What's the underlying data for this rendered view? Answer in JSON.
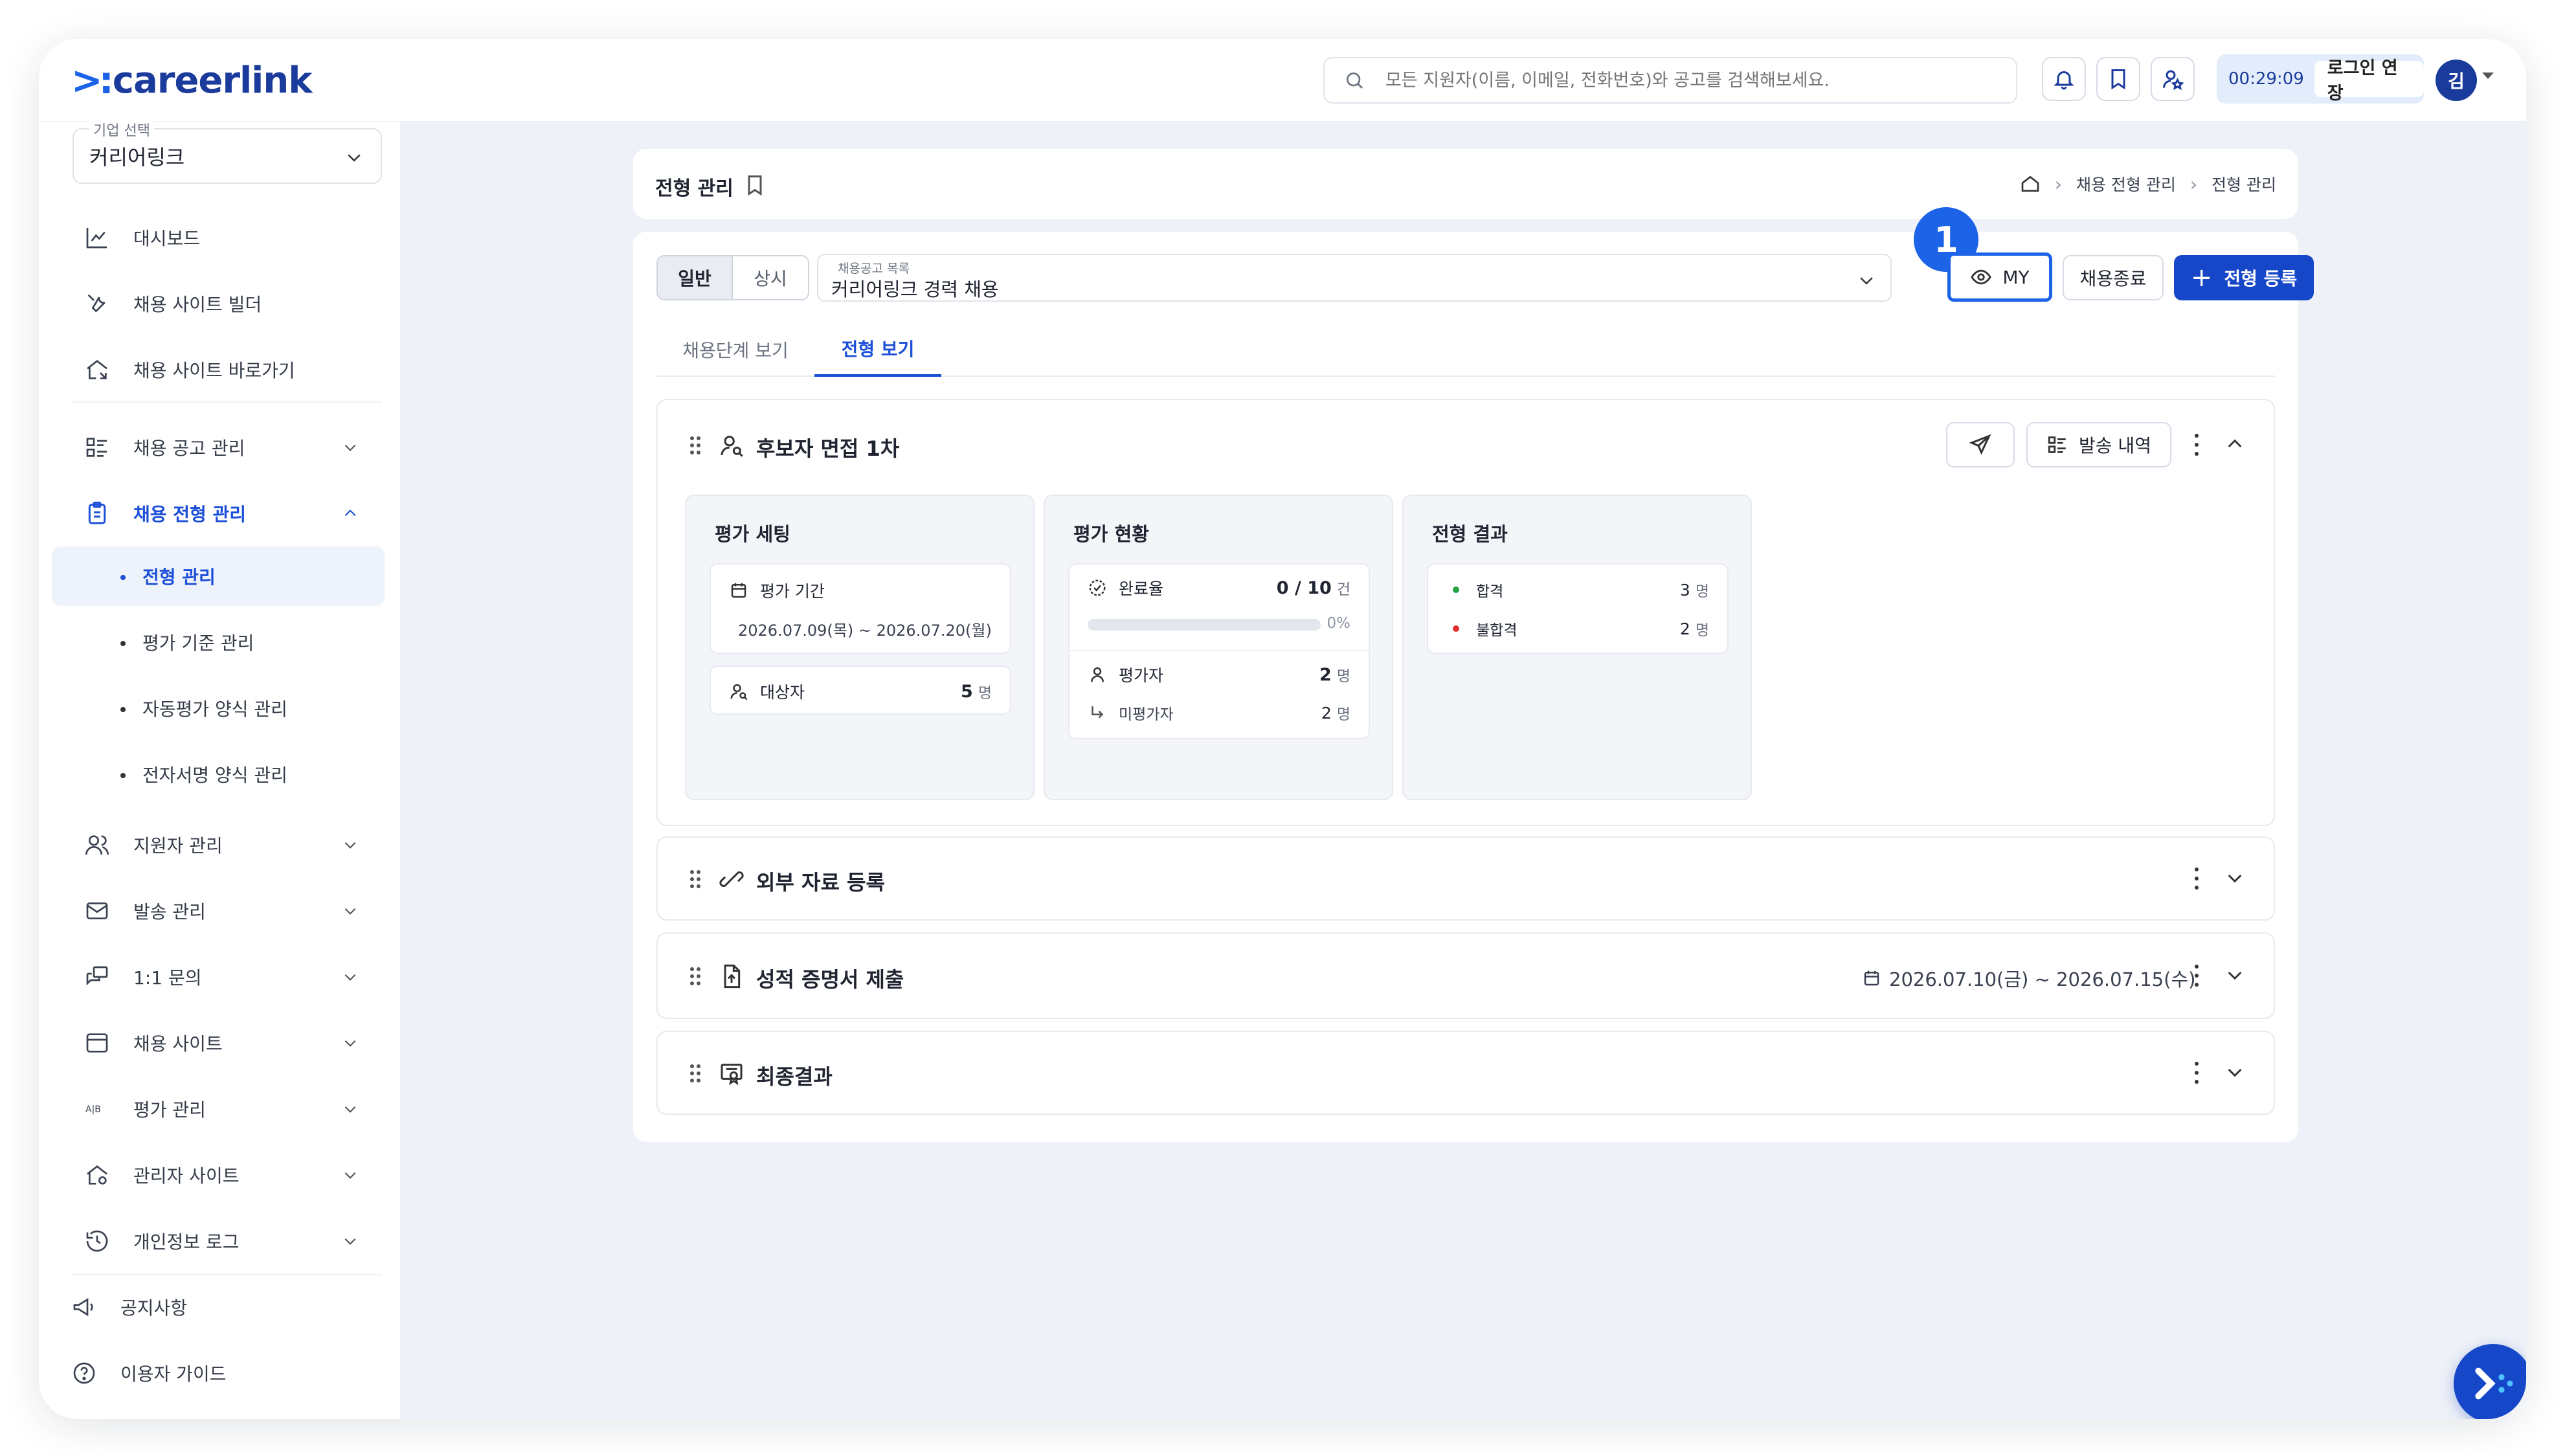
{
  "header": {
    "logo_mark": ">:",
    "logo_text": "careerlink",
    "search_placeholder": "모든 지원자(이름, 이메일, 전화번호)와 공고를 검색해보세요.",
    "timer": "00:29:09",
    "extend_label": "로그인 연장",
    "avatar_initial": "김"
  },
  "sidebar": {
    "company_label": "기업 선택",
    "company_value": "커리어링크",
    "items": [
      {
        "label": "대시보드",
        "icon": "chart-icon"
      },
      {
        "label": "채용 사이트 빌더",
        "icon": "tools-icon"
      },
      {
        "label": "채용 사이트 바로가기",
        "icon": "home-link-icon"
      },
      {
        "label": "채용 공고 관리",
        "icon": "list-icon"
      },
      {
        "label": "채용 전형 관리",
        "icon": "clipboard-icon"
      },
      {
        "label": "지원자 관리",
        "icon": "users-icon"
      },
      {
        "label": "발송 관리",
        "icon": "mail-icon"
      },
      {
        "label": "1:1 문의",
        "icon": "chat-icon"
      },
      {
        "label": "채용 사이트",
        "icon": "browser-icon"
      },
      {
        "label": "평가 관리",
        "icon": "ab-icon"
      },
      {
        "label": "관리자 사이트",
        "icon": "admin-home-icon"
      },
      {
        "label": "개인정보 로그",
        "icon": "history-icon"
      },
      {
        "label": "공지사항",
        "icon": "megaphone-icon"
      },
      {
        "label": "이용자 가이드",
        "icon": "help-icon"
      }
    ],
    "sub_items": [
      "전형 관리",
      "평가 기준 관리",
      "자동평가 양식 관리",
      "전자서명 양식 관리"
    ],
    "ab_text": "A|B"
  },
  "page": {
    "title": "전형 관리",
    "breadcrumb": [
      "채용 전형 관리",
      "전형 관리"
    ]
  },
  "toolbar": {
    "seg_general": "일반",
    "seg_regular": "상시",
    "post_label": "채용공고 목록",
    "post_value": "커리어링크 경력 채용",
    "badge": "1",
    "my_label": "MY",
    "end_label": "채용종료",
    "register_plus": "+",
    "register_label": "전형 등록"
  },
  "tabs": [
    "채용단계 보기",
    "전형 보기"
  ],
  "steps": [
    {
      "title": "후보자 면접 1차",
      "history_label": "발송 내역",
      "settings": {
        "title": "평가 세팅",
        "period_label": "평가 기간",
        "period_value": "2026.07.09(목) ~ 2026.07.20(월)",
        "target_label": "대상자",
        "target_count": "5",
        "target_unit": "명"
      },
      "status": {
        "title": "평가 현황",
        "completion_label": "완료율",
        "completion_value": "0 / 10",
        "completion_unit": "건",
        "progress_percent": 0,
        "progress_text": "0%",
        "evaluator_label": "평가자",
        "evaluator_count": "2",
        "evaluator_unit": "명",
        "unevaluated_label": "미평가자",
        "unevaluated_count": "2",
        "unevaluated_unit": "명"
      },
      "result": {
        "title": "전형 결과",
        "pass_label": "합격",
        "pass_count": "3",
        "pass_unit": "명",
        "fail_label": "불합격",
        "fail_count": "2",
        "fail_unit": "명"
      }
    },
    {
      "title": "외부 자료 등록"
    },
    {
      "title": "성적 증명서 제출",
      "date": "2026.07.10(금) ~ 2026.07.15(수)"
    },
    {
      "title": "최종결과"
    }
  ],
  "colors": {
    "accent": "#1c63e8",
    "primary": "#1747c9",
    "pass": "#22a043",
    "fail": "#e03131"
  }
}
